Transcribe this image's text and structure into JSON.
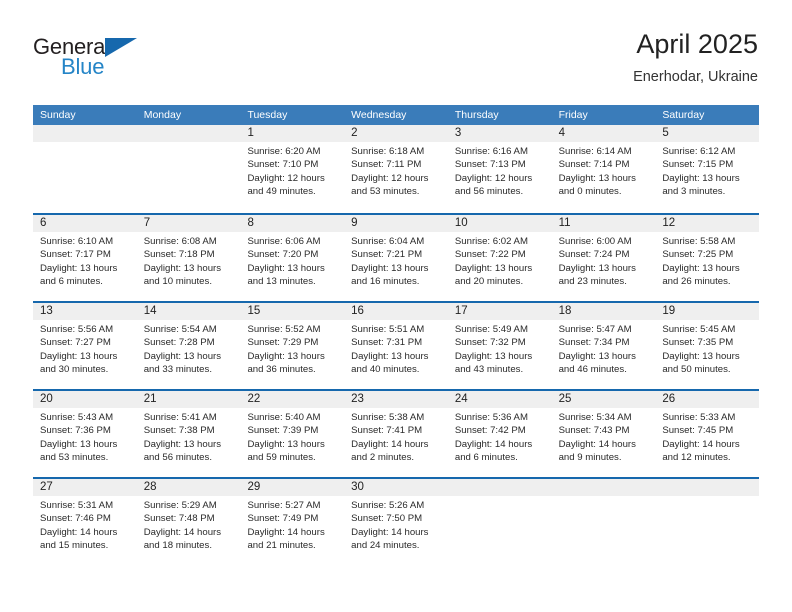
{
  "brand": {
    "name_part1": "General",
    "name_part2": "Blue",
    "flag_icon": "triangle-flag-icon",
    "color_dark": "#231f20",
    "color_blue": "#2585c7",
    "flag_color": "#1668ad"
  },
  "header": {
    "title": "April 2025",
    "subtitle": "Enerhodar, Ukraine",
    "accent_color": "#3a7cba",
    "row_border_color": "#1668ad",
    "band_color": "#efefef"
  },
  "weekdays": [
    "Sunday",
    "Monday",
    "Tuesday",
    "Wednesday",
    "Thursday",
    "Friday",
    "Saturday"
  ],
  "weeks": [
    [
      {
        "day": "",
        "sunrise": "",
        "sunset": "",
        "daylight1": "",
        "daylight2": ""
      },
      {
        "day": "",
        "sunrise": "",
        "sunset": "",
        "daylight1": "",
        "daylight2": ""
      },
      {
        "day": "1",
        "sunrise": "Sunrise: 6:20 AM",
        "sunset": "Sunset: 7:10 PM",
        "daylight1": "Daylight: 12 hours",
        "daylight2": "and 49 minutes."
      },
      {
        "day": "2",
        "sunrise": "Sunrise: 6:18 AM",
        "sunset": "Sunset: 7:11 PM",
        "daylight1": "Daylight: 12 hours",
        "daylight2": "and 53 minutes."
      },
      {
        "day": "3",
        "sunrise": "Sunrise: 6:16 AM",
        "sunset": "Sunset: 7:13 PM",
        "daylight1": "Daylight: 12 hours",
        "daylight2": "and 56 minutes."
      },
      {
        "day": "4",
        "sunrise": "Sunrise: 6:14 AM",
        "sunset": "Sunset: 7:14 PM",
        "daylight1": "Daylight: 13 hours",
        "daylight2": "and 0 minutes."
      },
      {
        "day": "5",
        "sunrise": "Sunrise: 6:12 AM",
        "sunset": "Sunset: 7:15 PM",
        "daylight1": "Daylight: 13 hours",
        "daylight2": "and 3 minutes."
      }
    ],
    [
      {
        "day": "6",
        "sunrise": "Sunrise: 6:10 AM",
        "sunset": "Sunset: 7:17 PM",
        "daylight1": "Daylight: 13 hours",
        "daylight2": "and 6 minutes."
      },
      {
        "day": "7",
        "sunrise": "Sunrise: 6:08 AM",
        "sunset": "Sunset: 7:18 PM",
        "daylight1": "Daylight: 13 hours",
        "daylight2": "and 10 minutes."
      },
      {
        "day": "8",
        "sunrise": "Sunrise: 6:06 AM",
        "sunset": "Sunset: 7:20 PM",
        "daylight1": "Daylight: 13 hours",
        "daylight2": "and 13 minutes."
      },
      {
        "day": "9",
        "sunrise": "Sunrise: 6:04 AM",
        "sunset": "Sunset: 7:21 PM",
        "daylight1": "Daylight: 13 hours",
        "daylight2": "and 16 minutes."
      },
      {
        "day": "10",
        "sunrise": "Sunrise: 6:02 AM",
        "sunset": "Sunset: 7:22 PM",
        "daylight1": "Daylight: 13 hours",
        "daylight2": "and 20 minutes."
      },
      {
        "day": "11",
        "sunrise": "Sunrise: 6:00 AM",
        "sunset": "Sunset: 7:24 PM",
        "daylight1": "Daylight: 13 hours",
        "daylight2": "and 23 minutes."
      },
      {
        "day": "12",
        "sunrise": "Sunrise: 5:58 AM",
        "sunset": "Sunset: 7:25 PM",
        "daylight1": "Daylight: 13 hours",
        "daylight2": "and 26 minutes."
      }
    ],
    [
      {
        "day": "13",
        "sunrise": "Sunrise: 5:56 AM",
        "sunset": "Sunset: 7:27 PM",
        "daylight1": "Daylight: 13 hours",
        "daylight2": "and 30 minutes."
      },
      {
        "day": "14",
        "sunrise": "Sunrise: 5:54 AM",
        "sunset": "Sunset: 7:28 PM",
        "daylight1": "Daylight: 13 hours",
        "daylight2": "and 33 minutes."
      },
      {
        "day": "15",
        "sunrise": "Sunrise: 5:52 AM",
        "sunset": "Sunset: 7:29 PM",
        "daylight1": "Daylight: 13 hours",
        "daylight2": "and 36 minutes."
      },
      {
        "day": "16",
        "sunrise": "Sunrise: 5:51 AM",
        "sunset": "Sunset: 7:31 PM",
        "daylight1": "Daylight: 13 hours",
        "daylight2": "and 40 minutes."
      },
      {
        "day": "17",
        "sunrise": "Sunrise: 5:49 AM",
        "sunset": "Sunset: 7:32 PM",
        "daylight1": "Daylight: 13 hours",
        "daylight2": "and 43 minutes."
      },
      {
        "day": "18",
        "sunrise": "Sunrise: 5:47 AM",
        "sunset": "Sunset: 7:34 PM",
        "daylight1": "Daylight: 13 hours",
        "daylight2": "and 46 minutes."
      },
      {
        "day": "19",
        "sunrise": "Sunrise: 5:45 AM",
        "sunset": "Sunset: 7:35 PM",
        "daylight1": "Daylight: 13 hours",
        "daylight2": "and 50 minutes."
      }
    ],
    [
      {
        "day": "20",
        "sunrise": "Sunrise: 5:43 AM",
        "sunset": "Sunset: 7:36 PM",
        "daylight1": "Daylight: 13 hours",
        "daylight2": "and 53 minutes."
      },
      {
        "day": "21",
        "sunrise": "Sunrise: 5:41 AM",
        "sunset": "Sunset: 7:38 PM",
        "daylight1": "Daylight: 13 hours",
        "daylight2": "and 56 minutes."
      },
      {
        "day": "22",
        "sunrise": "Sunrise: 5:40 AM",
        "sunset": "Sunset: 7:39 PM",
        "daylight1": "Daylight: 13 hours",
        "daylight2": "and 59 minutes."
      },
      {
        "day": "23",
        "sunrise": "Sunrise: 5:38 AM",
        "sunset": "Sunset: 7:41 PM",
        "daylight1": "Daylight: 14 hours",
        "daylight2": "and 2 minutes."
      },
      {
        "day": "24",
        "sunrise": "Sunrise: 5:36 AM",
        "sunset": "Sunset: 7:42 PM",
        "daylight1": "Daylight: 14 hours",
        "daylight2": "and 6 minutes."
      },
      {
        "day": "25",
        "sunrise": "Sunrise: 5:34 AM",
        "sunset": "Sunset: 7:43 PM",
        "daylight1": "Daylight: 14 hours",
        "daylight2": "and 9 minutes."
      },
      {
        "day": "26",
        "sunrise": "Sunrise: 5:33 AM",
        "sunset": "Sunset: 7:45 PM",
        "daylight1": "Daylight: 14 hours",
        "daylight2": "and 12 minutes."
      }
    ],
    [
      {
        "day": "27",
        "sunrise": "Sunrise: 5:31 AM",
        "sunset": "Sunset: 7:46 PM",
        "daylight1": "Daylight: 14 hours",
        "daylight2": "and 15 minutes."
      },
      {
        "day": "28",
        "sunrise": "Sunrise: 5:29 AM",
        "sunset": "Sunset: 7:48 PM",
        "daylight1": "Daylight: 14 hours",
        "daylight2": "and 18 minutes."
      },
      {
        "day": "29",
        "sunrise": "Sunrise: 5:27 AM",
        "sunset": "Sunset: 7:49 PM",
        "daylight1": "Daylight: 14 hours",
        "daylight2": "and 21 minutes."
      },
      {
        "day": "30",
        "sunrise": "Sunrise: 5:26 AM",
        "sunset": "Sunset: 7:50 PM",
        "daylight1": "Daylight: 14 hours",
        "daylight2": "and 24 minutes."
      },
      {
        "day": "",
        "sunrise": "",
        "sunset": "",
        "daylight1": "",
        "daylight2": ""
      },
      {
        "day": "",
        "sunrise": "",
        "sunset": "",
        "daylight1": "",
        "daylight2": ""
      },
      {
        "day": "",
        "sunrise": "",
        "sunset": "",
        "daylight1": "",
        "daylight2": ""
      }
    ]
  ]
}
